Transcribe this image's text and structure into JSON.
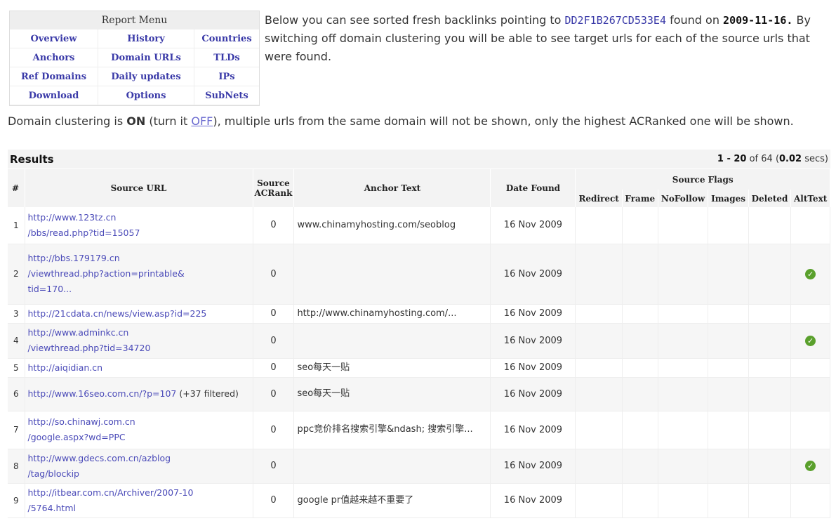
{
  "menu": {
    "title": "Report Menu",
    "items": [
      {
        "label": "Overview"
      },
      {
        "label": "History"
      },
      {
        "label": "Countries"
      },
      {
        "label": "Anchors"
      },
      {
        "label": "Domain URLs"
      },
      {
        "label": "TLDs"
      },
      {
        "label": "Ref Domains"
      },
      {
        "label": "Daily updates"
      },
      {
        "label": "IPs"
      },
      {
        "label": "Download"
      },
      {
        "label": "Options"
      },
      {
        "label": "SubNets"
      }
    ]
  },
  "intro": {
    "text_before": "Below you can see sorted fresh backlinks pointing to ",
    "target": "DD2F1B267CD533E4",
    "text_mid": " found on ",
    "date": "2009-11-16.",
    "text_after": " By switching off domain clustering you will be able to see target urls for each of the source urls that were found."
  },
  "cluster": {
    "prefix": "Domain clustering is ",
    "state": "ON",
    "mid": " (turn it ",
    "toggle": "OFF",
    "suffix": "), multiple urls from the same domain will not be shown, only the highest ACRanked one will be shown."
  },
  "results": {
    "title": "Results",
    "range": "1 - 20",
    "of": " of 64 (",
    "time": "0.02",
    "secs": " secs)"
  },
  "columns": {
    "num": "#",
    "source_url": "Source URL",
    "source_rank_1": "Source",
    "source_rank_2": "ACRank",
    "anchor": "Anchor Text",
    "date": "Date Found",
    "flags": "Source Flags",
    "redirect": "Redirect",
    "frame": "Frame",
    "nofollow": "NoFollow",
    "images": "Images",
    "deleted": "Deleted",
    "alttext": "AltText"
  },
  "rows": [
    {
      "n": "1",
      "url1": "http://www.123tz.cn",
      "url2": "/bbs/read.php?tid=15057",
      "url3": "",
      "filtered": "",
      "rank": "0",
      "anchor": "www.chinamyhosting.com/seoblog",
      "date": "16 Nov 2009",
      "alt": false
    },
    {
      "n": "2",
      "url1": "http://bbs.179179.cn",
      "url2": "/viewthread.php?action=printable&",
      "url3": "tid=170...",
      "filtered": "",
      "rank": "0",
      "anchor": "",
      "date": "16 Nov 2009",
      "alt": true
    },
    {
      "n": "3",
      "url1": "http://21cdata.cn/news/view.asp?id=225",
      "url2": "",
      "url3": "",
      "filtered": "",
      "rank": "0",
      "anchor": "http://www.chinamyhosting.com/...",
      "date": "16 Nov 2009",
      "alt": false
    },
    {
      "n": "4",
      "url1": "http://www.adminkc.cn",
      "url2": "/viewthread.php?tid=34720",
      "url3": "",
      "filtered": "",
      "rank": "0",
      "anchor": "",
      "date": "16 Nov 2009",
      "alt": true
    },
    {
      "n": "5",
      "url1": "http://aiqidian.cn",
      "url2": "",
      "url3": "",
      "filtered": "",
      "rank": "0",
      "anchor": "seo每天一贴",
      "date": "16 Nov 2009",
      "alt": false
    },
    {
      "n": "6",
      "url1": "http://www.16seo.com.cn/?p=107",
      "url2": "",
      "url3": "",
      "filtered": " (+37 filtered)",
      "rank": "0",
      "anchor": "seo每天一贴",
      "date": "16 Nov 2009",
      "alt": false
    },
    {
      "n": "7",
      "url1": "http://so.chinawj.com.cn",
      "url2": "/google.aspx?wd=PPC",
      "url3": "",
      "filtered": "",
      "rank": "0",
      "anchor": "ppc竞价排名搜索引擎&ndash; 搜索引擎...",
      "date": "16 Nov 2009",
      "alt": false
    },
    {
      "n": "8",
      "url1": "http://www.gdecs.com.cn/azblog",
      "url2": "/tag/blockip",
      "url3": "",
      "filtered": "",
      "rank": "0",
      "anchor": "",
      "date": "16 Nov 2009",
      "alt": true
    },
    {
      "n": "9",
      "url1": "http://itbear.com.cn/Archiver/2007-10",
      "url2": "/5764.html",
      "url3": "",
      "filtered": "",
      "rank": "0",
      "anchor": "google pr值越来越不重要了",
      "date": "16 Nov 2009",
      "alt": false
    }
  ],
  "icons": {
    "alttext_flag": "check-circle-icon"
  },
  "colors": {
    "link": "#3a3aa8",
    "check": "#5aa02c"
  }
}
